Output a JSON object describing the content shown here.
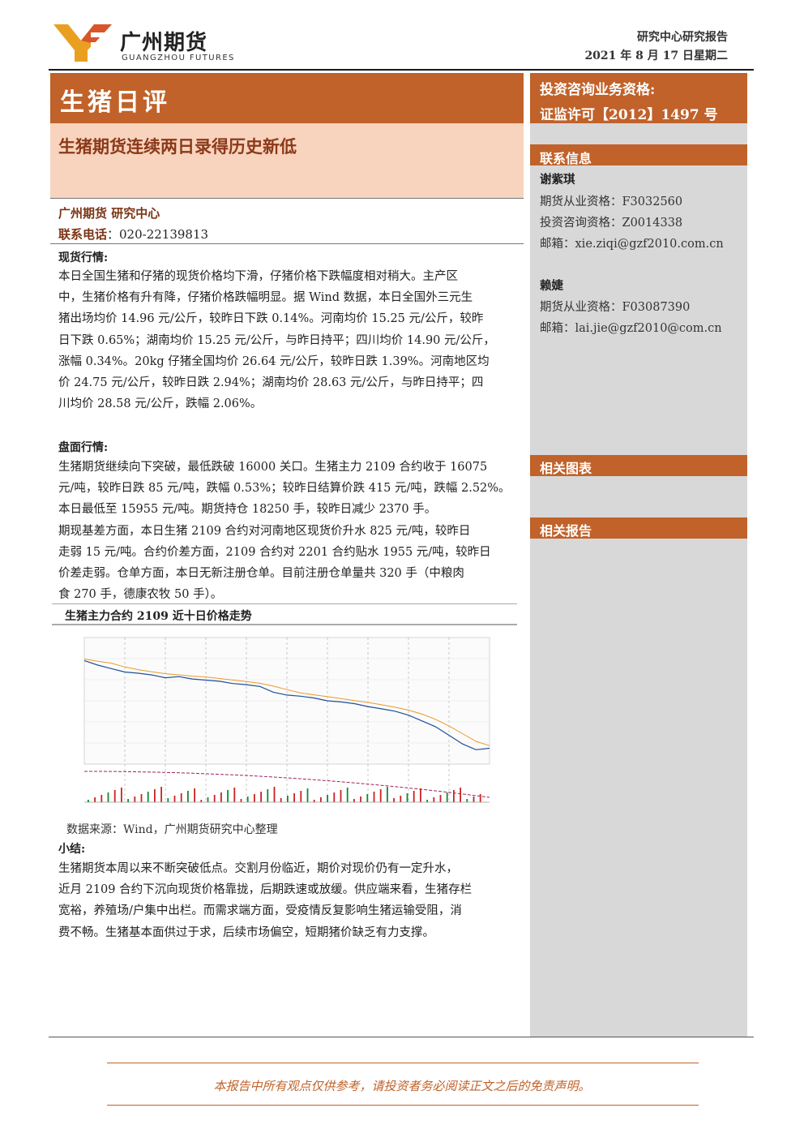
{
  "header": {
    "brand_cn": "广州期货",
    "brand_en": "GUANGZHOU FUTURES",
    "report_type": "研究中心研究报告",
    "report_date": "2021 年 8 月 17 日星期二"
  },
  "title": {
    "main": "生猪日评",
    "subtitle": "生猪期货连续两日录得历史新低"
  },
  "org": {
    "name": "广州期货  研究中心",
    "phone_label": "联系电话",
    "phone": "：020-22139813"
  },
  "sections": {
    "spot_head": "现货行情:",
    "spot_lines": [
      "本日全国生猪和仔猪的现货价格均下滑，仔猪价格下跌幅度相对稍大。主产区",
      "中，生猪价格有升有降，仔猪价格跌幅明显。据 Wind 数据，本日全国外三元生",
      "猪出场均价 14.96 元/公斤，较昨日下跌 0.14%。河南均价 15.25 元/公斤，较昨",
      "日下跌 0.65%；湖南均价 15.25 元/公斤，与昨日持平；四川均价 14.90 元/公斤，",
      "涨幅 0.34%。20kg 仔猪全国均价 26.64 元/公斤，较昨日跌 1.39%。河南地区均",
      "价 24.75 元/公斤，较昨日跌 2.94%；湖南均价 28.63 元/公斤，与昨日持平；四",
      "川均价 28.58 元/公斤，跌幅 2.06%。"
    ],
    "futures_head": "盘面行情:",
    "futures_lines": [
      "生猪期货继续向下突破，最低跌破 16000 关口。生猪主力 2109 合约收于 16075",
      "元/吨，较昨日跌 85 元/吨，跌幅 0.53%；较昨日结算价跌 415 元/吨，跌幅 2.52%。",
      "本日最低至 15955 元/吨。期货持仓 18250 手，较昨日减少 2370 手。",
      "期现基差方面，本日生猪 2109 合约对河南地区现货价升水 825 元/吨，较昨日",
      "走弱 15 元/吨。合约价差方面，2109 合约对 2201 合约贴水 1955 元/吨，较昨日",
      "价差走弱。仓单方面，本日无新注册仓单。目前注册仓单量共 320 手（中粮肉",
      "食 270 手，德康农牧 50 手）。"
    ],
    "summary_head": "小结:",
    "summary_lines": [
      "生猪期货本周以来不断突破低点。交割月份临近，期价对现价仍有一定升水，",
      "近月 2109 合约下沉向现货价格靠拢，后期跌速或放缓。供应端来看，生猪存栏",
      "宽裕，养殖场/户集中出栏。而需求端方面，受疫情反复影响生猪运输受阻，消",
      "费不畅。生猪基本面供过于求，后续市场偏空，短期猪价缺乏有力支撑。"
    ]
  },
  "sidebar": {
    "qual_line1": "投资咨询业务资格:",
    "qual_line2": "证监许可【2012】1497 号",
    "contact_head": "联系信息",
    "analyst1": {
      "name": "谢紫琪",
      "cert1": "期货从业资格：F3032560",
      "cert2": "投资咨询资格：Z0014338",
      "email": "邮箱：xie.ziqi@gzf2010.com.cn"
    },
    "analyst2": {
      "name": "赖婕",
      "cert1": "期货从业资格：F03087390",
      "email": "邮箱：lai.jie@gzf2010@com.cn"
    },
    "related_charts": "相关图表",
    "related_reports": "相关报告"
  },
  "chart": {
    "title": "生猪主力合约 2109 近十日价格走势",
    "caption": "数据来源：Wind，广州期货研究中心整理"
  },
  "chart_data": {
    "type": "line",
    "title": "生猪主力合约 2109 近十日价格走势",
    "x": [
      0,
      1,
      2,
      3,
      4,
      5,
      6,
      7,
      8,
      9,
      10,
      11,
      12,
      13,
      14,
      15,
      16,
      17,
      18,
      19,
      20,
      21,
      22,
      23,
      24,
      25,
      26,
      27,
      28,
      29,
      30
    ],
    "series": [
      {
        "values": [
          17600,
          17520,
          17460,
          17400,
          17380,
          17350,
          17300,
          17320,
          17280,
          17260,
          17240,
          17200,
          17180,
          17150,
          17050,
          17000,
          16980,
          16950,
          16900,
          16880,
          16850,
          16800,
          16760,
          16720,
          16650,
          16550,
          16450,
          16300,
          16150,
          16050,
          16075
        ]
      }
    ],
    "ylim": [
      15800,
      18000
    ],
    "colors": {
      "price": "#1f4e9c",
      "ma": "#e89a2a",
      "volume_up": "#cc2222",
      "volume_down": "#118833",
      "secondary": "#a02060"
    }
  }
}
